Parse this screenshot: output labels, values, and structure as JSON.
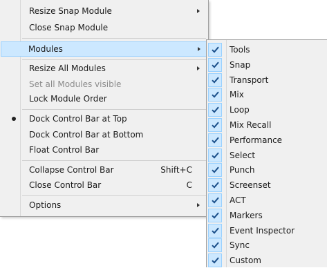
{
  "main_menu": {
    "items": [
      {
        "label": "Resize Snap Module",
        "submenu": true
      },
      {
        "label": "Close Snap Module"
      },
      {
        "label": "Modules",
        "submenu": true,
        "highlight": true
      },
      {
        "label": "Resize All Modules",
        "submenu": true
      },
      {
        "label": "Set all Modules visible",
        "disabled": true
      },
      {
        "label": "Lock Module Order"
      },
      {
        "label": "Dock Control Bar at Top",
        "selected": true
      },
      {
        "label": "Dock Control Bar at Bottom"
      },
      {
        "label": "Float Control Bar"
      },
      {
        "label": "Collapse Control Bar",
        "shortcut": "Shift+C"
      },
      {
        "label": "Close Control Bar",
        "shortcut": "C"
      },
      {
        "label": "Options",
        "submenu": true
      }
    ]
  },
  "modules_submenu": {
    "items": [
      {
        "label": "Tools",
        "checked": true
      },
      {
        "label": "Snap",
        "checked": true
      },
      {
        "label": "Transport",
        "checked": true
      },
      {
        "label": "Mix",
        "checked": true
      },
      {
        "label": "Loop",
        "checked": true
      },
      {
        "label": "Mix Recall",
        "checked": true
      },
      {
        "label": "Performance",
        "checked": true
      },
      {
        "label": "Select",
        "checked": true
      },
      {
        "label": "Punch",
        "checked": true
      },
      {
        "label": "Screenset",
        "checked": true
      },
      {
        "label": "ACT",
        "checked": true
      },
      {
        "label": "Markers",
        "checked": true
      },
      {
        "label": "Event Inspector",
        "checked": true
      },
      {
        "label": "Sync",
        "checked": true
      },
      {
        "label": "Custom",
        "checked": true
      }
    ]
  },
  "colors": {
    "menu_background": "#f0f0f0",
    "highlight": "#cce8ff",
    "highlight_border": "#99d1ff",
    "check": "#1b4f8a",
    "disabled_text": "#8b8b8b"
  }
}
